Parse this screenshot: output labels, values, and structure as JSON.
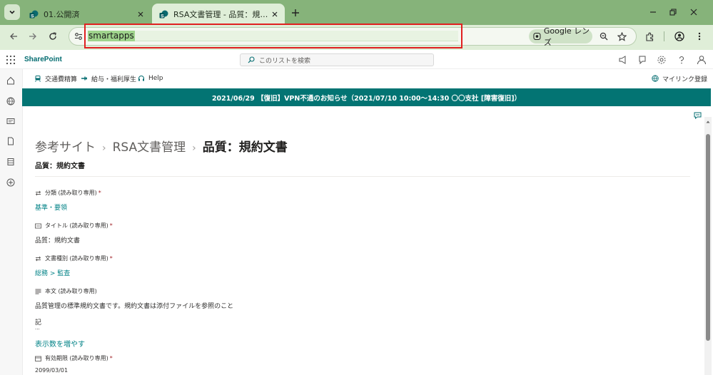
{
  "browser": {
    "tabs": [
      {
        "title": "01.公開済",
        "active": false
      },
      {
        "title": "RSA文書管理 - 品質：規約文書",
        "active": true
      }
    ],
    "address_bar": {
      "url": "smartapps"
    },
    "lens_label": "Google レンズ"
  },
  "sharepoint": {
    "brand": "SharePoint",
    "search_placeholder": "このリストを検索",
    "hub_nav": {
      "links": [
        "交通費精算",
        "給与・福利厚生",
        "Help"
      ],
      "my_links": "マイリンク登録"
    },
    "banner_text": "2021/06/29 【復旧】VPN不通のお知らせ（2021/07/10 10:00～14:30 〇〇支社 [障害復旧]）"
  },
  "page": {
    "breadcrumb": [
      "参考サイト",
      "RSA文書管理",
      "品質：規約文書"
    ],
    "breadcrumb_separator": "›",
    "subtitle": "品質：規約文書",
    "fields": {
      "category": {
        "label": "分類 (読み取り専用)",
        "required": "*",
        "value": "基準・要領"
      },
      "title": {
        "label": "タイトル (読み取り専用)",
        "required": "*",
        "value": "品質：規約文書"
      },
      "doc_type": {
        "label": "文書種別 (読み取り専用)",
        "required": "*",
        "value": "総務 > 監査"
      },
      "body": {
        "label": "本文 (読み取り専用)",
        "line1": "品質管理の標準規約文書です。規約文書は添付ファイルを参照のこと",
        "line2": "記",
        "line3": "...",
        "show_more": "表示数を増やす"
      },
      "expiry": {
        "label": "有効期限 (読み取り専用)",
        "required": "*",
        "value": "2099/03/01"
      }
    }
  },
  "colors": {
    "theme_teal": "#037473",
    "link_teal": "#038387",
    "tab_green": "#86b37a",
    "annotation_red": "#e02020"
  }
}
